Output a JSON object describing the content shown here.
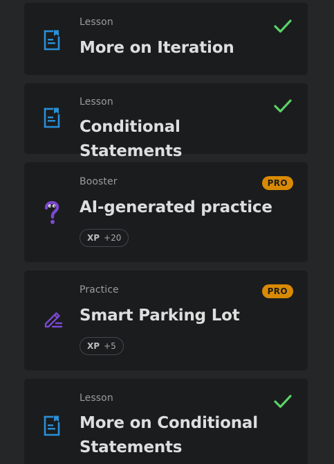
{
  "items": [
    {
      "category": "Lesson",
      "title": "More on Iteration",
      "status_icon": "check-icon",
      "type_icon": "document-icon"
    },
    {
      "category": "Lesson",
      "title": "Conditional Statements",
      "status_icon": "check-icon",
      "type_icon": "document-icon"
    },
    {
      "category": "Booster",
      "title": "AI-generated practice",
      "badge": "PRO",
      "xp_label": "XP",
      "xp_value": "+20",
      "type_icon": "question-mark-icon"
    },
    {
      "category": "Practice",
      "title": "Smart Parking Lot",
      "badge": "PRO",
      "xp_label": "XP",
      "xp_value": "+5",
      "type_icon": "pencil-icon"
    },
    {
      "category": "Lesson",
      "title": "More on Conditional Statements",
      "status_icon": "check-icon",
      "type_icon": "document-icon"
    }
  ],
  "colors": {
    "background": "#252628",
    "card": "#1b1c1e",
    "lesson_icon": "#2a8fd6",
    "booster_practice_icon": "#7b48d1",
    "check": "#5ad364",
    "pro_badge": "#d98a04"
  }
}
